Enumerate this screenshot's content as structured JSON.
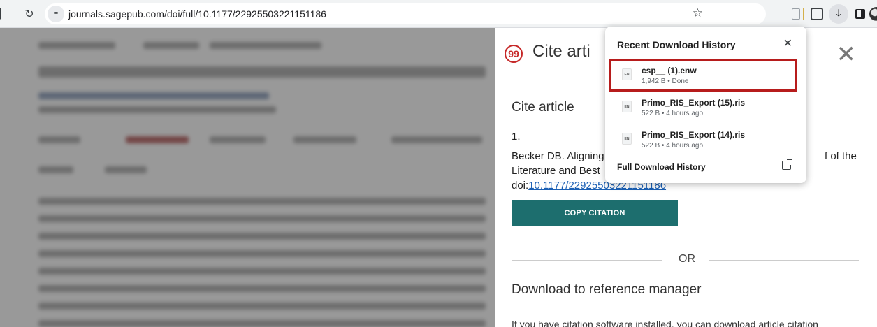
{
  "browser": {
    "url": "journals.sagepub.com/doi/full/10.1177/22925503221151186"
  },
  "cite_panel": {
    "title": "Cite arti",
    "section_heading": "Cite article",
    "item_number": "1.",
    "citation_line1": "Becker DB. Aligning",
    "citation_line1_tail": "f of the",
    "citation_line2": "Literature and Best",
    "citation_doi_prefix": "doi:",
    "citation_doi_link": "10.1177/22925503221151186",
    "copy_button": "COPY CITATION",
    "or_text": "OR",
    "download_heading": "Download to reference manager",
    "download_description": "If you have citation software installed, you can download article citation"
  },
  "download_popup": {
    "title": "Recent Download History",
    "items": [
      {
        "name": "csp__ (1).enw",
        "meta": "1,942 B • Done",
        "type_label": "EN"
      },
      {
        "name": "Primo_RIS_Export (15).ris",
        "meta": "522 B • 4 hours ago",
        "type_label": "EN"
      },
      {
        "name": "Primo_RIS_Export (14).ris",
        "meta": "522 B • 4 hours ago",
        "type_label": "EN"
      }
    ],
    "full_history": "Full Download History"
  },
  "colors": {
    "accent_teal": "#1d6e6e",
    "highlight_red": "#b71c1c",
    "quote_red": "#c62828"
  }
}
